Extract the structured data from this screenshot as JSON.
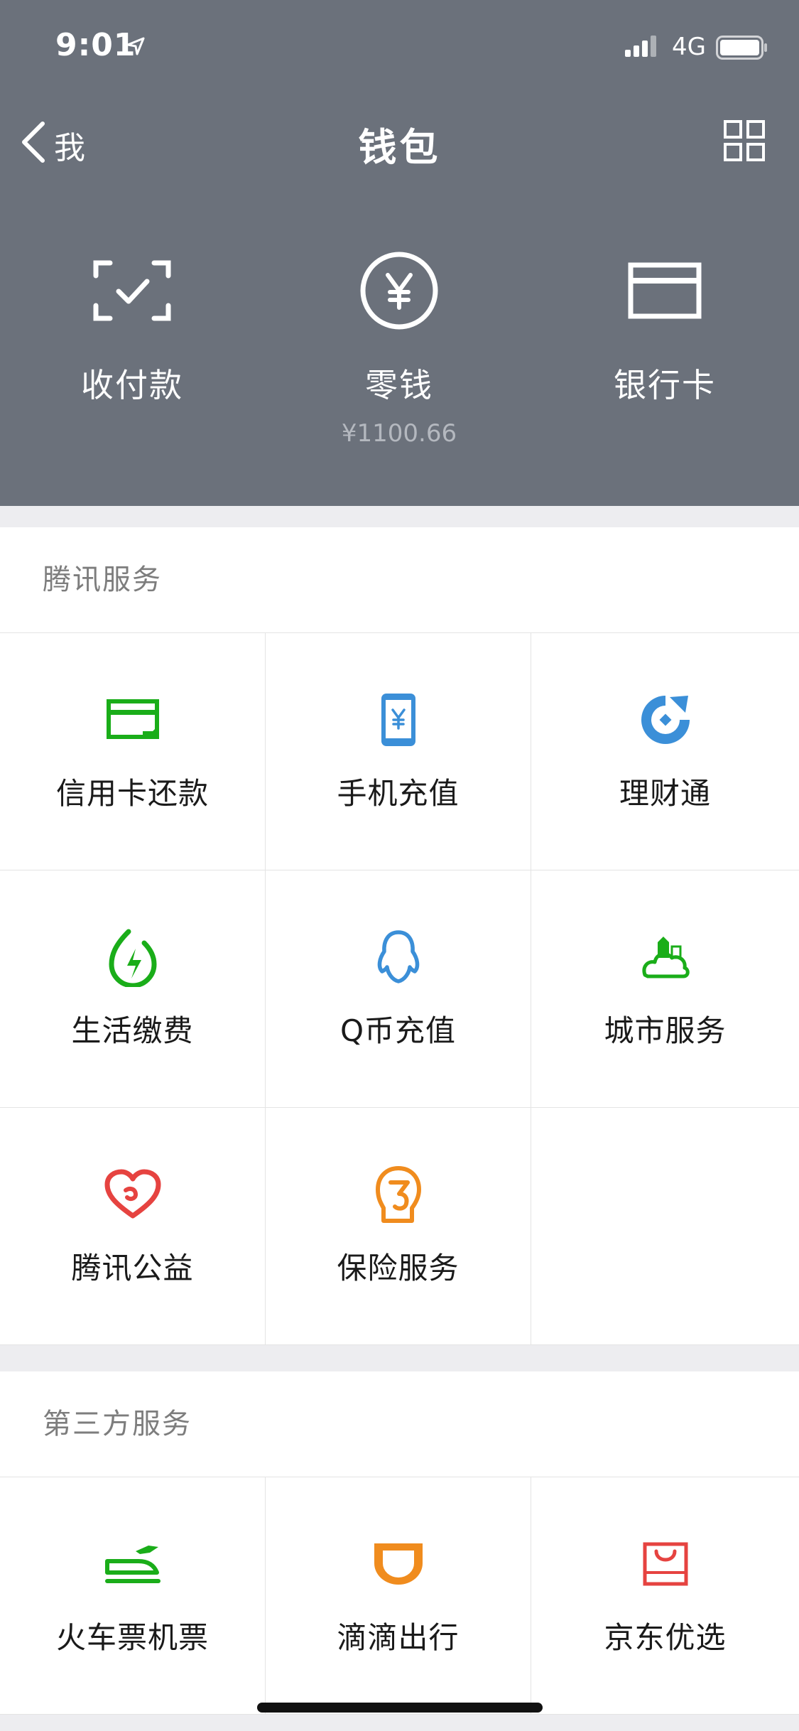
{
  "status_bar": {
    "time": "9:01",
    "network": "4G"
  },
  "nav": {
    "back_label": "我",
    "title": "钱包"
  },
  "top_actions": [
    {
      "label": "收付款",
      "icon": "scan-pay-icon"
    },
    {
      "label": "零钱",
      "sub": "¥1100.66",
      "icon": "yuan-coin-icon"
    },
    {
      "label": "银行卡",
      "icon": "bank-card-icon"
    }
  ],
  "tencent_services": {
    "title": "腾讯服务",
    "items": [
      {
        "label": "信用卡还款",
        "icon": "credit-card-repay-icon",
        "color": "#1aad19"
      },
      {
        "label": "手机充值",
        "icon": "mobile-topup-icon",
        "color": "#3b8fd8"
      },
      {
        "label": "理财通",
        "icon": "wealth-icon",
        "color": "#3b8fd8"
      },
      {
        "label": "生活缴费",
        "icon": "utility-bill-icon",
        "color": "#1aad19"
      },
      {
        "label": "Q币充值",
        "icon": "qq-penguin-icon",
        "color": "#3b8fd8"
      },
      {
        "label": "城市服务",
        "icon": "city-service-icon",
        "color": "#1aad19"
      },
      {
        "label": "腾讯公益",
        "icon": "charity-heart-icon",
        "color": "#e64340"
      },
      {
        "label": "保险服务",
        "icon": "insurance-icon",
        "color": "#f08c1e"
      }
    ]
  },
  "third_party_services": {
    "title": "第三方服务",
    "items": [
      {
        "label": "火车票机票",
        "icon": "train-plane-icon",
        "color": "#1aad19"
      },
      {
        "label": "滴滴出行",
        "icon": "didi-icon",
        "color": "#f08c1e"
      },
      {
        "label": "京东优选",
        "icon": "shopping-bag-icon",
        "color": "#e64340"
      }
    ]
  },
  "colors": {
    "header_bg": "#6b717b",
    "page_bg": "#ededf0",
    "green": "#1aad19",
    "blue": "#3b8fd8",
    "orange": "#f08c1e",
    "red": "#e64340"
  }
}
